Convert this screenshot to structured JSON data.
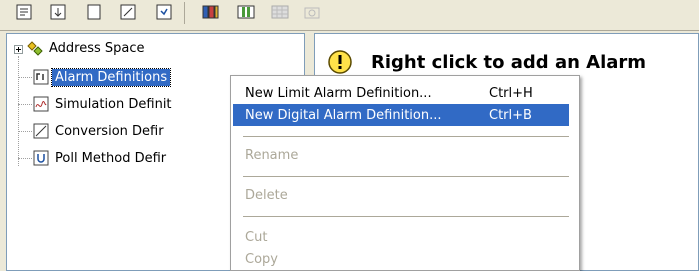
{
  "toolbar": {
    "buttons": [
      {
        "name": "report-icon"
      },
      {
        "name": "export-icon"
      },
      {
        "name": "new-icon"
      },
      {
        "name": "edit-icon"
      },
      {
        "name": "properties-icon"
      },
      {
        "name": "library-icon"
      },
      {
        "name": "columns-icon"
      },
      {
        "name": "disabled-grid-icon"
      },
      {
        "name": "disabled-camera-icon"
      }
    ]
  },
  "tree": {
    "root": {
      "label": "Address Space",
      "icon": "address-space-icon"
    },
    "items": [
      {
        "label": "Alarm Definitions",
        "icon": "alarm-definitions-icon",
        "selected": true
      },
      {
        "label": "Simulation Definit",
        "icon": "simulation-definitions-icon"
      },
      {
        "label": "Conversion Defir",
        "icon": "conversion-definitions-icon"
      },
      {
        "label": "Poll Method Defir",
        "icon": "poll-method-definitions-icon"
      }
    ]
  },
  "right_pane": {
    "message": "Right click to add an Alarm",
    "icon": "exclamation-icon"
  },
  "context_menu": {
    "items": [
      {
        "label": "New Limit Alarm Definition...",
        "shortcut": "Ctrl+H"
      },
      {
        "label": "New Digital Alarm Definition...",
        "shortcut": "Ctrl+B",
        "highlighted": true
      },
      {
        "label": "Rename",
        "disabled": true
      },
      {
        "label": "Delete",
        "disabled": true
      },
      {
        "label": "Cut",
        "disabled": true
      },
      {
        "label": "Copy",
        "disabled": true
      }
    ]
  },
  "colors": {
    "selection": "#316ac5",
    "disabled_text": "#aca899",
    "window_bg": "#ece9d8"
  }
}
